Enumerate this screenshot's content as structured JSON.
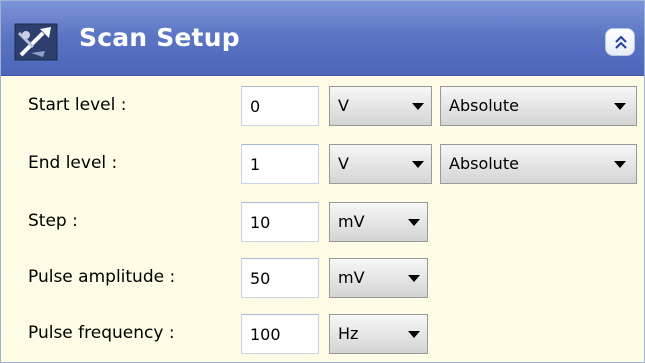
{
  "panel": {
    "title": "Scan Setup",
    "app_icon": "scan-tool-icon",
    "collapse_icon": "double-chevron-up-icon",
    "header_color": "#5a74c4",
    "background_color": "#fefce4"
  },
  "rows": [
    {
      "label": "Start level :",
      "value": "0",
      "unit": "V",
      "mode": "Absolute"
    },
    {
      "label": "End level :",
      "value": "1",
      "unit": "V",
      "mode": "Absolute"
    },
    {
      "label": "Step :",
      "value": "10",
      "unit": "mV"
    },
    {
      "label": "Pulse amplitude :",
      "value": "50",
      "unit": "mV"
    },
    {
      "label": "Pulse frequency :",
      "value": "100",
      "unit": "Hz"
    }
  ]
}
